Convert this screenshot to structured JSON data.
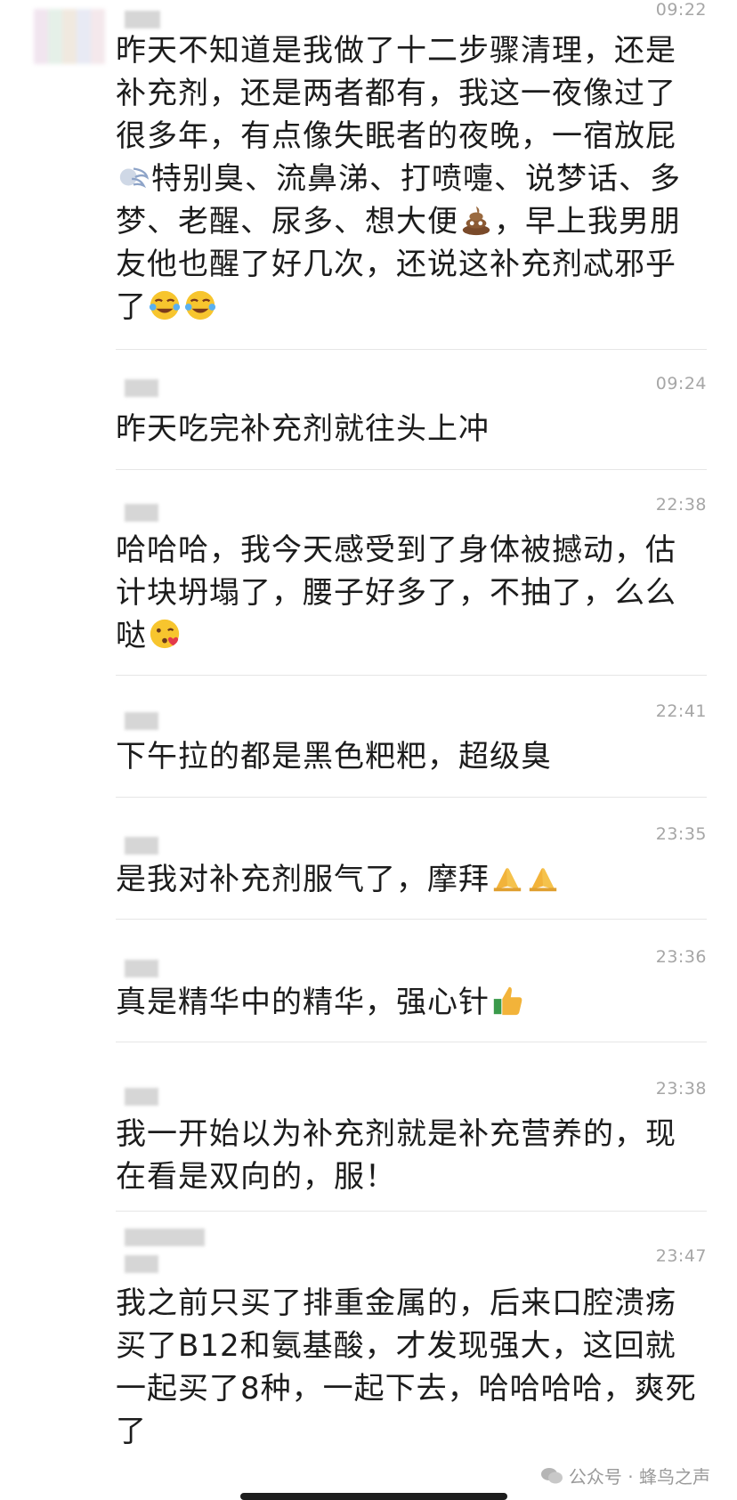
{
  "messages": [
    {
      "time": "09:22",
      "text": "昨天不知道是我做了十二步骤清理，还是补充剂，还是两者都有，我这一夜像过了很多年，有点像失眠者的夜晚，一宿放屁",
      "text2": "特别臭、流鼻涕、打喷嚏、说梦话、多梦、老醒、尿多、想大便",
      "text3": "，早上我男朋友他也醒了好几次，还说这补充剂忒邪乎了"
    },
    {
      "time": "09:24",
      "text": "昨天吃完补充剂就往头上冲"
    },
    {
      "time": "22:38",
      "text": "哈哈哈，我今天感受到了身体被撼动，估计块坍塌了，腰子好多了，不抽了，么么哒"
    },
    {
      "time": "22:41",
      "text": "下午拉的都是黑色粑粑，超级臭"
    },
    {
      "time": "23:35",
      "text": "是我对补充剂服气了，摩拜"
    },
    {
      "time": "23:36",
      "text": "真是精华中的精华，强心针"
    },
    {
      "time": "23:38",
      "text": "我一开始以为补充剂就是补充营养的，现在看是双向的，服！"
    },
    {
      "time": "23:47",
      "text": "我之前只买了排重金属的，后来口腔溃疡买了B12和氨基酸，才发现强大，这回就一起买了8种，一起下去，哈哈哈哈，爽死了"
    }
  ],
  "watermark": {
    "text": "公众号 · 蜂鸟之声",
    "icon": "wechat-icon"
  },
  "icons": [
    "wind-face-icon",
    "poop-icon",
    "laughing-crying-icon",
    "kissing-face-icon",
    "praying-hands-icon",
    "thumbs-up-icon"
  ]
}
